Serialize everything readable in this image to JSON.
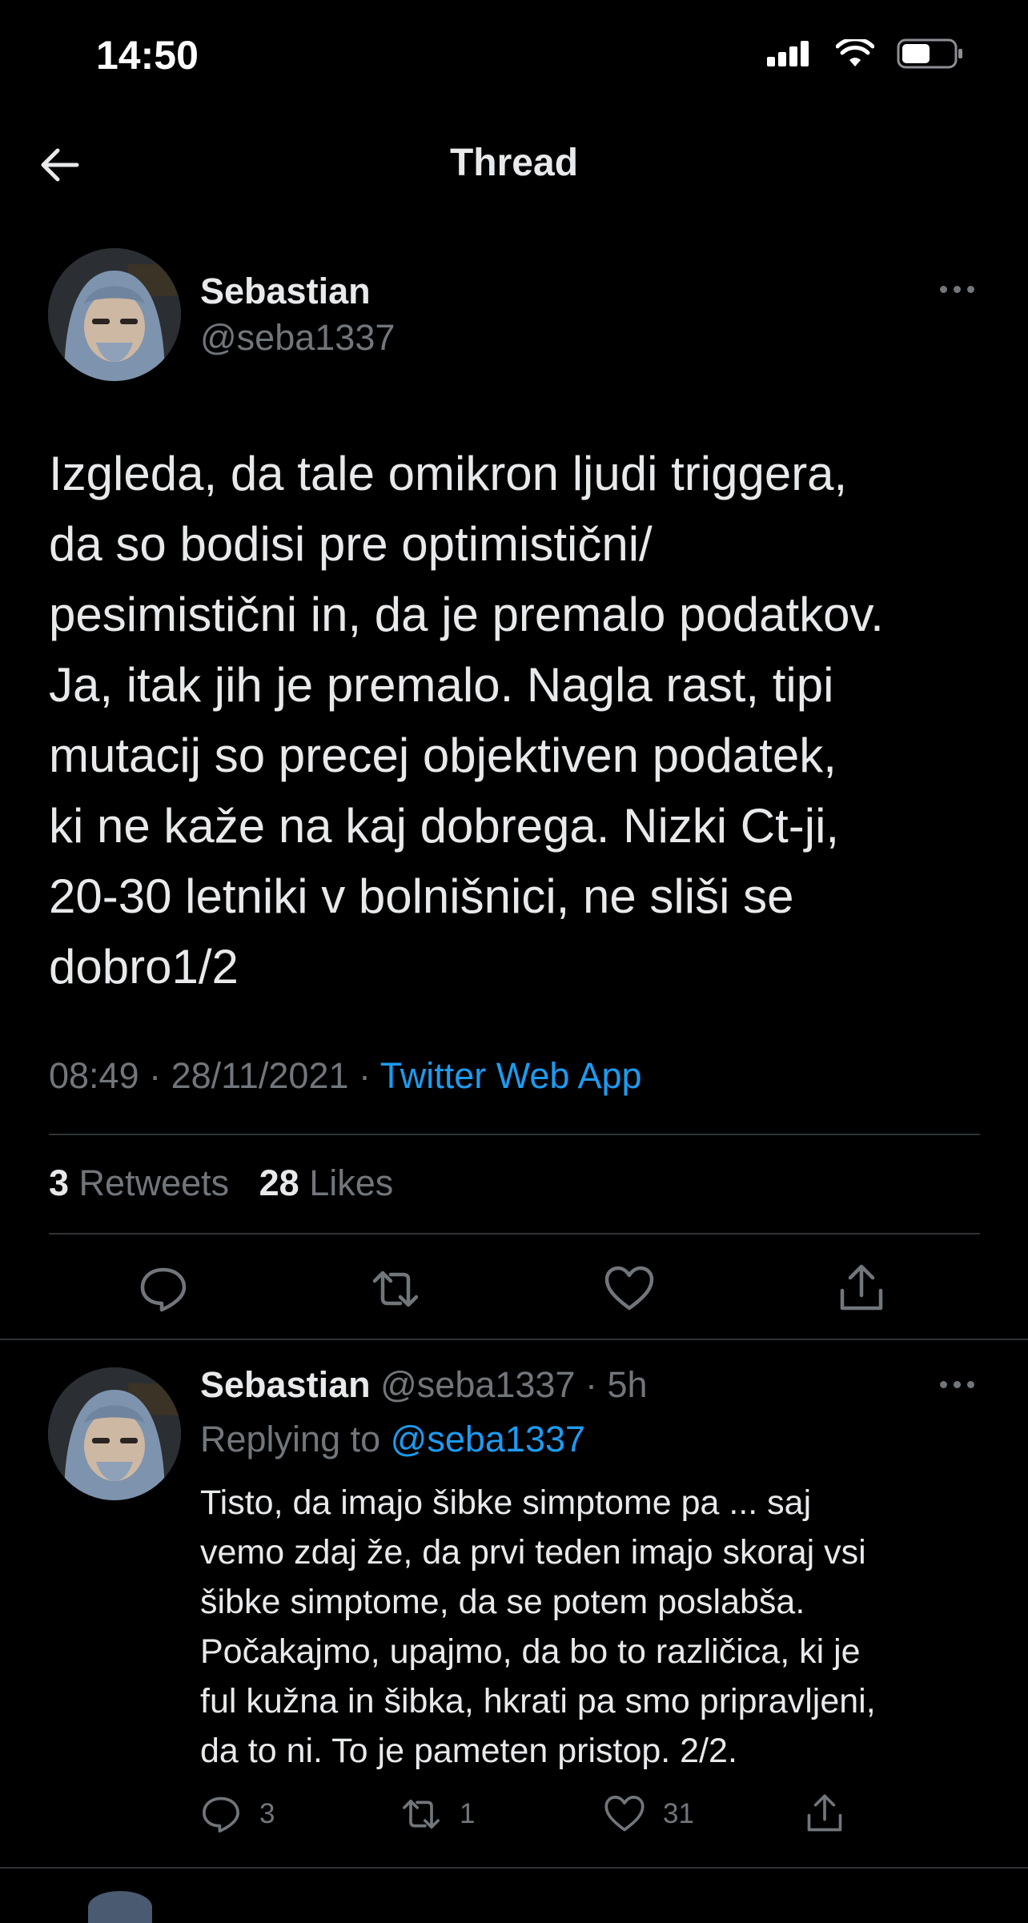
{
  "status_bar": {
    "time": "14:50"
  },
  "header": {
    "title": "Thread"
  },
  "main_tweet": {
    "author_name": "Sebastian",
    "author_handle": "@seba1337",
    "text": "Izgleda, da tale omikron ljudi triggera,\nda so bodisi pre optimistični/\npesimistični in, da je premalo podatkov.\nJa, itak jih je premalo. Nagla rast, tipi\nmutacij so precej objektiven podatek,\nki ne kaže na kaj dobrega. Nizki Ct-ji,\n20-30 letniki v bolnišnici, ne sliši se\ndobro1/2",
    "time": "08:49",
    "date": "28/11/2021",
    "source": "Twitter Web App",
    "retweet_count": "3",
    "retweet_label": "Retweets",
    "like_count": "28",
    "like_label": "Likes"
  },
  "reply_tweet": {
    "author_name": "Sebastian",
    "author_handle": "@seba1337",
    "age": "5h",
    "replying_to_label": "Replying to",
    "replying_to_handle": "@seba1337",
    "text": "Tisto, da imajo šibke simptome pa ... saj\nvemo zdaj že, da prvi teden imajo skoraj vsi\nšibke simptome, da se potem poslabša.\nPočakajmo, upajmo, da bo to različica, ki je\nful kužna in šibka, hkrati pa smo pripravljeni,\nda to ni. To je pameten pristop. 2/2.",
    "reply_count": "3",
    "retweet_count": "1",
    "like_count": "31"
  },
  "colors": {
    "background": "#000000",
    "text": "#e7e9ea",
    "muted": "#71767b",
    "link": "#1d9bf0",
    "divider": "#2f3336"
  },
  "icons": [
    "back-arrow-icon",
    "more-icon",
    "reply-icon",
    "retweet-icon",
    "like-icon",
    "share-icon",
    "signal-icon",
    "wifi-icon",
    "battery-icon"
  ]
}
